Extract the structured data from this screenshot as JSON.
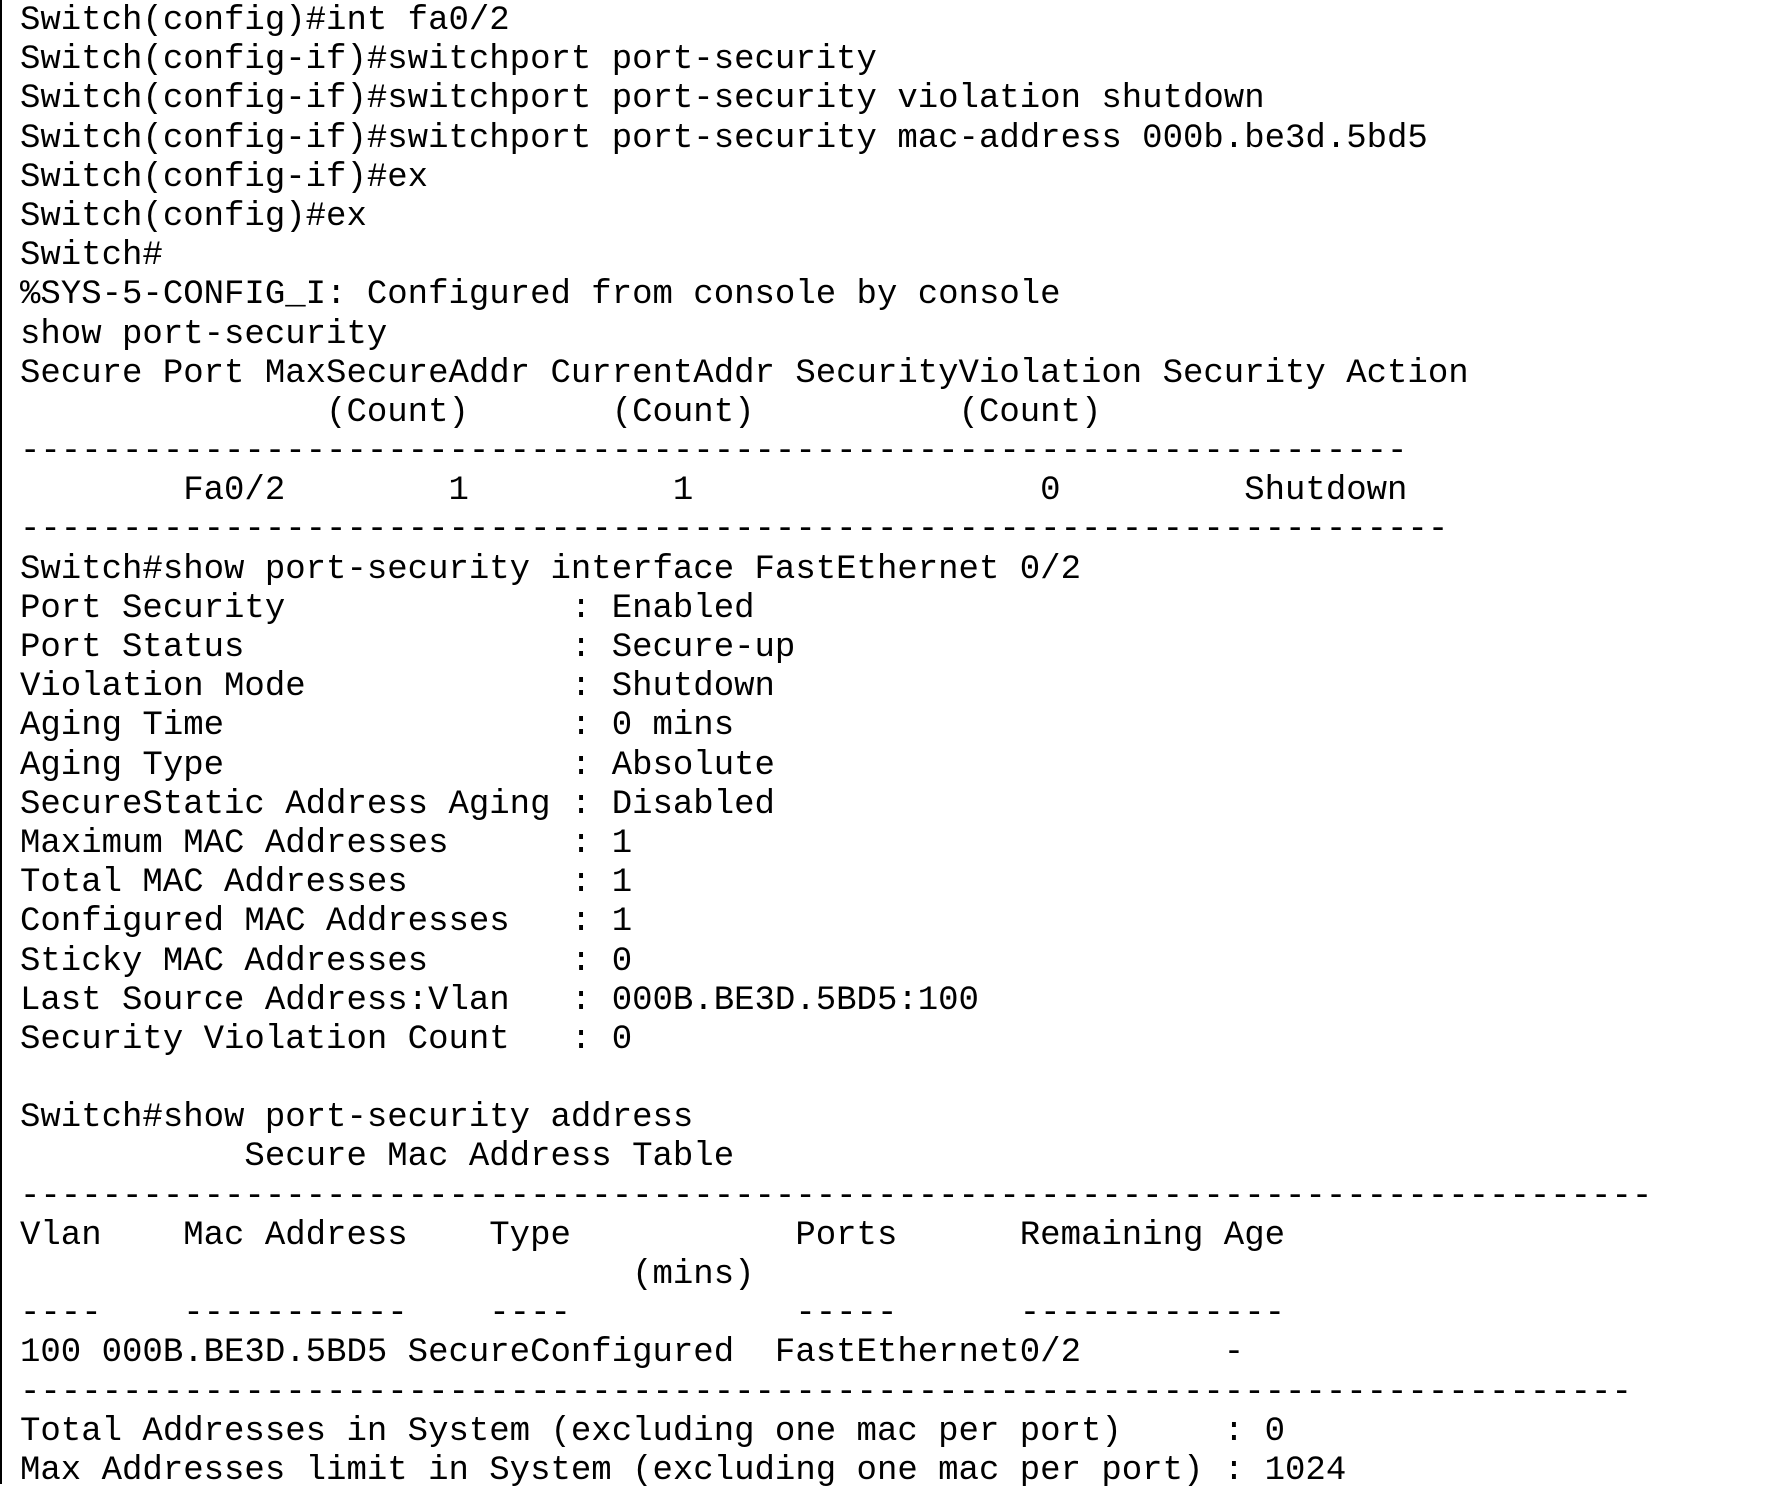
{
  "terminal": {
    "lines": [
      "Switch(config)#int fa0/2",
      "Switch(config-if)#switchport port-security",
      "Switch(config-if)#switchport port-security violation shutdown",
      "Switch(config-if)#switchport port-security mac-address 000b.be3d.5bd5",
      "Switch(config-if)#ex",
      "Switch(config)#ex",
      "Switch#",
      "%SYS-5-CONFIG_I: Configured from console by console",
      "show port-security",
      "Secure Port MaxSecureAddr CurrentAddr SecurityViolation Security Action",
      "               (Count)       (Count)          (Count)",
      "--------------------------------------------------------------------",
      "        Fa0/2        1          1                 0         Shutdown",
      "----------------------------------------------------------------------",
      "Switch#show port-security interface FastEthernet 0/2",
      "Port Security              : Enabled",
      "Port Status                : Secure-up",
      "Violation Mode             : Shutdown",
      "Aging Time                 : 0 mins",
      "Aging Type                 : Absolute",
      "SecureStatic Address Aging : Disabled",
      "Maximum MAC Addresses      : 1",
      "Total MAC Addresses        : 1",
      "Configured MAC Addresses   : 1",
      "Sticky MAC Addresses       : 0",
      "Last Source Address:Vlan   : 000B.BE3D.5BD5:100",
      "Security Violation Count   : 0",
      "",
      "Switch#show port-security address",
      "           Secure Mac Address Table",
      "--------------------------------------------------------------------------------",
      "Vlan    Mac Address    Type           Ports      Remaining Age",
      "                              (mins)",
      "----    -----------    ----           -----      -------------",
      "100 000B.BE3D.5BD5 SecureConfigured  FastEthernet0/2       -",
      "-------------------------------------------------------------------------------",
      "Total Addresses in System (excluding one mac per port)     : 0",
      "Max Addresses limit in System (excluding one mac per port) : 1024"
    ]
  }
}
